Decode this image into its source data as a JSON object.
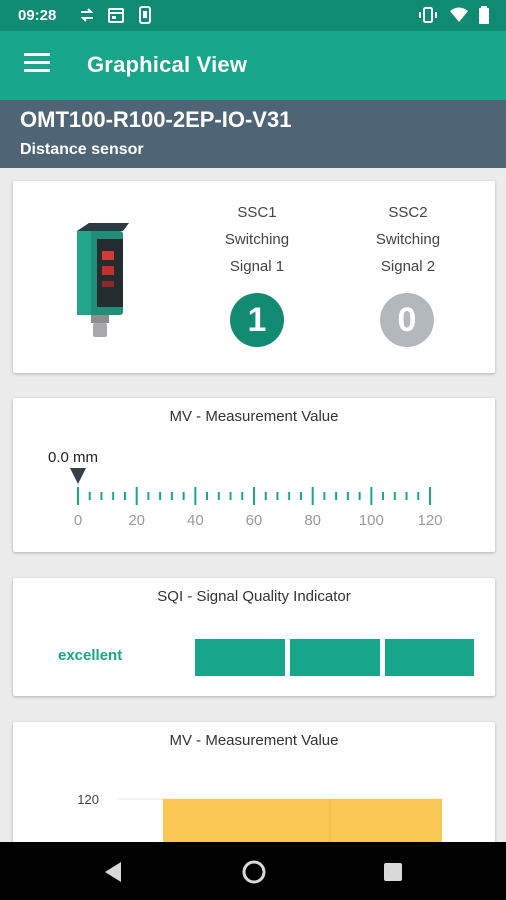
{
  "status_bar": {
    "time": "09:28",
    "icons": [
      "sync-icon",
      "calendar-icon",
      "phone-icon",
      "vibrate-icon",
      "wifi-icon",
      "battery-icon"
    ]
  },
  "app_bar": {
    "title": "Graphical View",
    "menu_icon": "hamburger-menu-icon"
  },
  "device": {
    "name": "OMT100-R100-2EP-IO-V31",
    "type": "Distance sensor"
  },
  "switching_signals": [
    {
      "code": "SSC1",
      "line1": "Switching",
      "line2": "Signal 1",
      "state": "1",
      "color": "#138a72"
    },
    {
      "code": "SSC2",
      "line1": "Switching",
      "line2": "Signal 2",
      "state": "0",
      "color": "#b3b8bd"
    }
  ],
  "measurement": {
    "title": "MV - Measurement Value",
    "value_label": "0.0 mm",
    "value": 0.0,
    "scale_labels": [
      "0",
      "20",
      "40",
      "60",
      "80",
      "100",
      "120"
    ],
    "scale_max": 120
  },
  "sqi": {
    "title": "SQI - Signal Quality Indicator",
    "level_label": "excellent",
    "bars_filled": 3,
    "bars_total": 3
  },
  "chart": {
    "title": "MV - Measurement Value"
  },
  "chart_data": {
    "type": "area",
    "title": "MV - Measurement Value",
    "xlabel": "",
    "ylabel": "",
    "y_tick_labels": [
      "120"
    ],
    "series": [
      {
        "values": [
          120,
          120
        ]
      }
    ],
    "fill_color": "#fbc855"
  },
  "colors": {
    "accent": "#17a68a",
    "status_bar": "#0f8b73",
    "device_header": "#4f6576",
    "ssc_active": "#138a72",
    "ssc_inactive": "#b3b8bd",
    "chart_fill": "#fbc855"
  },
  "nav_bar": {
    "icons": [
      "back-icon",
      "home-icon",
      "recents-icon"
    ]
  }
}
